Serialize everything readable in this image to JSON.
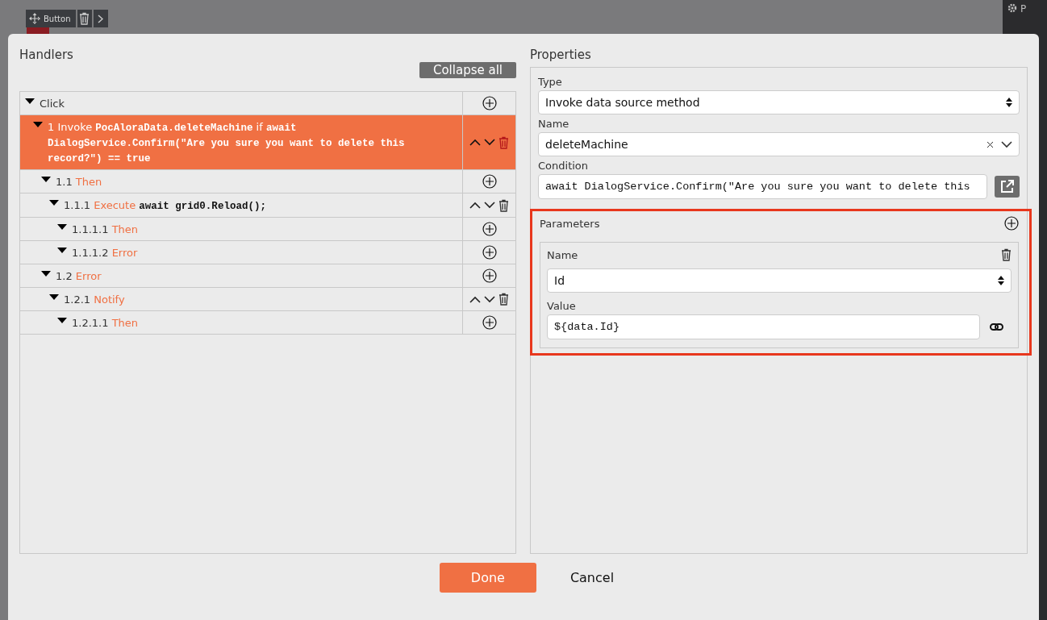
{
  "component_toolbar": {
    "label": "Button"
  },
  "side_panel": {
    "title": "P"
  },
  "handlers": {
    "title": "Handlers",
    "collapse_button": "Collapse all",
    "tree": [
      {
        "kind": "group",
        "selected": false,
        "parts": [
          {
            "kind": "word",
            "text": "Click"
          }
        ],
        "children": [
          {
            "kind": "step",
            "selected": true,
            "parts": [
              {
                "kind": "number",
                "text": "1"
              },
              {
                "kind": "action",
                "text": "Invoke"
              },
              {
                "kind": "code",
                "text": "PocAloraData.deleteMachine"
              },
              {
                "kind": "word",
                "text": "if"
              },
              {
                "kind": "code",
                "text": "await DialogService.Confirm(\"Are you sure you want to delete this record?\") == true"
              }
            ],
            "children": [
              {
                "kind": "group",
                "selected": false,
                "parts": [
                  {
                    "kind": "number",
                    "text": "1.1"
                  },
                  {
                    "kind": "action",
                    "text": "Then"
                  }
                ],
                "children": [
                  {
                    "kind": "step",
                    "selected": false,
                    "parts": [
                      {
                        "kind": "number",
                        "text": "1.1.1"
                      },
                      {
                        "kind": "action",
                        "text": "Execute"
                      },
                      {
                        "kind": "code",
                        "text": "await grid0.Reload();"
                      }
                    ],
                    "children": [
                      {
                        "kind": "group",
                        "selected": false,
                        "parts": [
                          {
                            "kind": "number",
                            "text": "1.1.1.1"
                          },
                          {
                            "kind": "action",
                            "text": "Then"
                          }
                        ]
                      },
                      {
                        "kind": "group",
                        "selected": false,
                        "parts": [
                          {
                            "kind": "number",
                            "text": "1.1.1.2"
                          },
                          {
                            "kind": "action",
                            "text": "Error"
                          }
                        ]
                      }
                    ]
                  }
                ]
              },
              {
                "kind": "group",
                "selected": false,
                "parts": [
                  {
                    "kind": "number",
                    "text": "1.2"
                  },
                  {
                    "kind": "action",
                    "text": "Error"
                  }
                ],
                "children": [
                  {
                    "kind": "step",
                    "selected": false,
                    "parts": [
                      {
                        "kind": "number",
                        "text": "1.2.1"
                      },
                      {
                        "kind": "action",
                        "text": "Notify"
                      }
                    ],
                    "children": [
                      {
                        "kind": "group",
                        "selected": false,
                        "parts": [
                          {
                            "kind": "number",
                            "text": "1.2.1.1"
                          },
                          {
                            "kind": "action",
                            "text": "Then"
                          }
                        ]
                      }
                    ]
                  }
                ]
              }
            ]
          }
        ]
      }
    ]
  },
  "properties": {
    "title": "Properties",
    "type": {
      "label": "Type",
      "value": "Invoke data source method"
    },
    "name": {
      "label": "Name",
      "value": "deleteMachine"
    },
    "condition": {
      "label": "Condition",
      "value": "await DialogService.Confirm(\"Are you sure you want to delete this"
    },
    "parameters": {
      "title": "Parameters",
      "highlighted": true,
      "items": [
        {
          "name_label": "Name",
          "name_value": "Id",
          "value_label": "Value",
          "value": "${data.Id}"
        }
      ]
    }
  },
  "buttons": {
    "done": "Done",
    "cancel": "Cancel"
  }
}
